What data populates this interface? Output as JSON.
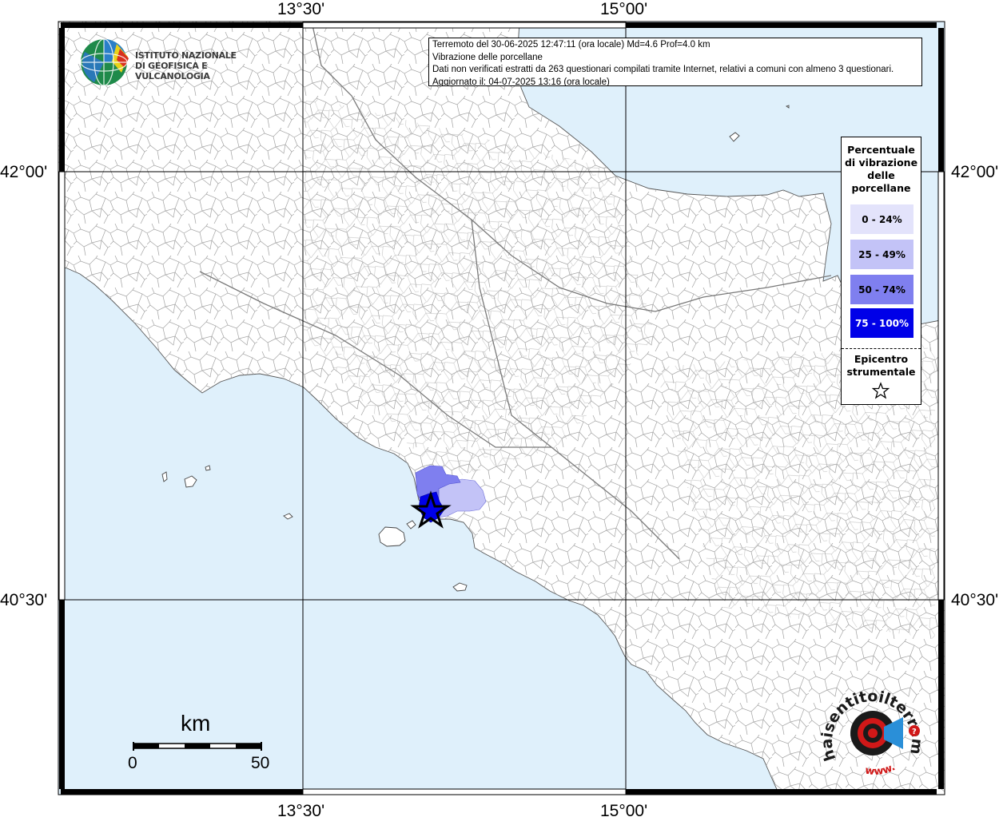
{
  "map": {
    "colors": {
      "sea": "#dff0fb",
      "land": "#ffffff",
      "boundary": "#9a9a9a",
      "frame": "#000000",
      "class_0_24": "#e3e3fb",
      "class_25_49": "#c3c3f7",
      "class_50_74": "#7f7fef",
      "class_75_100": "#0000e8"
    },
    "longitude_labels": [
      "13°30'",
      "15°00'"
    ],
    "latitude_labels": [
      "42°00'",
      "40°30'"
    ],
    "epicenter_symbol": "star-icon"
  },
  "info": {
    "line1": "Terremoto del 30-06-2025 12:47:11 (ora locale) Md=4.6 Prof=4.0 km",
    "line2": "Vibrazione delle porcellane",
    "line3": "Dati non verificati estratti da 263 questionari compilati tramite Internet, relativi a comuni con almeno 3 questionari.",
    "line4": "Aggiornato il: 04-07-2025 13:16 (ora locale)"
  },
  "ingv": {
    "line1": "ISTITUTO NAZIONALE",
    "line2": "DI GEOFISICA E VULCANOLOGIA"
  },
  "legend": {
    "title": "Percentuale di vibrazione delle porcellane",
    "title_lines": [
      "Percentuale",
      "di vibrazione",
      "delle",
      "porcellane"
    ],
    "classes": [
      {
        "label": "0 - 24%",
        "color": "#e3e3fb",
        "text_color": "#000000"
      },
      {
        "label": "25 - 49%",
        "color": "#c3c3f7",
        "text_color": "#000000"
      },
      {
        "label": "50 - 74%",
        "color": "#7f7fef",
        "text_color": "#000000"
      },
      {
        "label": "75 - 100%",
        "color": "#0000e8",
        "text_color": "#ffffff"
      }
    ],
    "epicenter_lines": [
      "Epicentro",
      "strumentale"
    ]
  },
  "scale": {
    "unit": "km",
    "min": "0",
    "max": "50"
  },
  "hst": {
    "text": "haisentitoilterremoto.it",
    "url": "www.",
    "colors": {
      "dark": "#1a1a1a",
      "red": "#d01818",
      "blue": "#2a8fd8"
    }
  }
}
